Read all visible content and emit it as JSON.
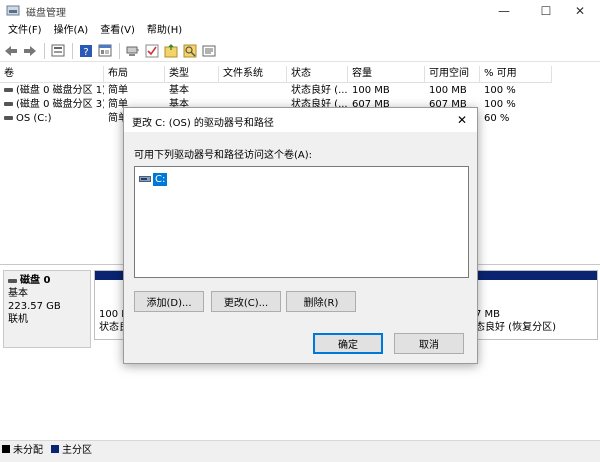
{
  "window": {
    "title": "磁盘管理",
    "minimize": "—",
    "maximize": "☐",
    "close": "✕"
  },
  "menu": [
    "文件(F)",
    "操作(A)",
    "查看(V)",
    "帮助(H)"
  ],
  "toolbar_icons": [
    "back-icon",
    "forward-icon",
    "disk-view-icon",
    "properties-icon",
    "help-icon",
    "connect-icon",
    "check-icon",
    "new-folder-icon",
    "search-icon",
    "list-view-icon"
  ],
  "volumes": {
    "columns": [
      "卷",
      "布局",
      "类型",
      "文件系统",
      "状态",
      "容量",
      "可用空间",
      "% 可用"
    ],
    "rows": [
      [
        "(磁盘 0 磁盘分区 1)",
        "简单",
        "基本",
        "",
        "状态良好 (...",
        "100 MB",
        "100 MB",
        "100 %"
      ],
      [
        "(磁盘 0 磁盘分区 3)",
        "简单",
        "基本",
        "",
        "状态良好 (...",
        "607 MB",
        "607 MB",
        "100 %"
      ],
      [
        "OS (C:)",
        "简单",
        "",
        "",
        "",
        "",
        "",
        "60 %"
      ]
    ]
  },
  "disk0": {
    "name": "磁盘 0",
    "type": "基本",
    "size": "223.57 GB",
    "status": "联机"
  },
  "partitions": [
    {
      "line1": "100 M",
      "line2": "状态良"
    },
    {
      "line1": "7 MB",
      "line2": "态良好 (恢复分区)"
    }
  ],
  "legend": [
    "未分配",
    "主分区"
  ],
  "dialog": {
    "title": "更改 C: (OS) 的驱动器号和路径",
    "close": "✕",
    "prompt": "可用下列驱动器号和路径访问这个卷(A):",
    "drive_item": "C:",
    "add_button": "添加(D)...",
    "change_button": "更改(C)...",
    "delete_button": "删除(R)",
    "ok_button": "确定",
    "cancel_button": "取消"
  },
  "colors": {
    "primary_partition": "#0a2472",
    "unallocated": "#000000",
    "accent": "#0078d7"
  }
}
